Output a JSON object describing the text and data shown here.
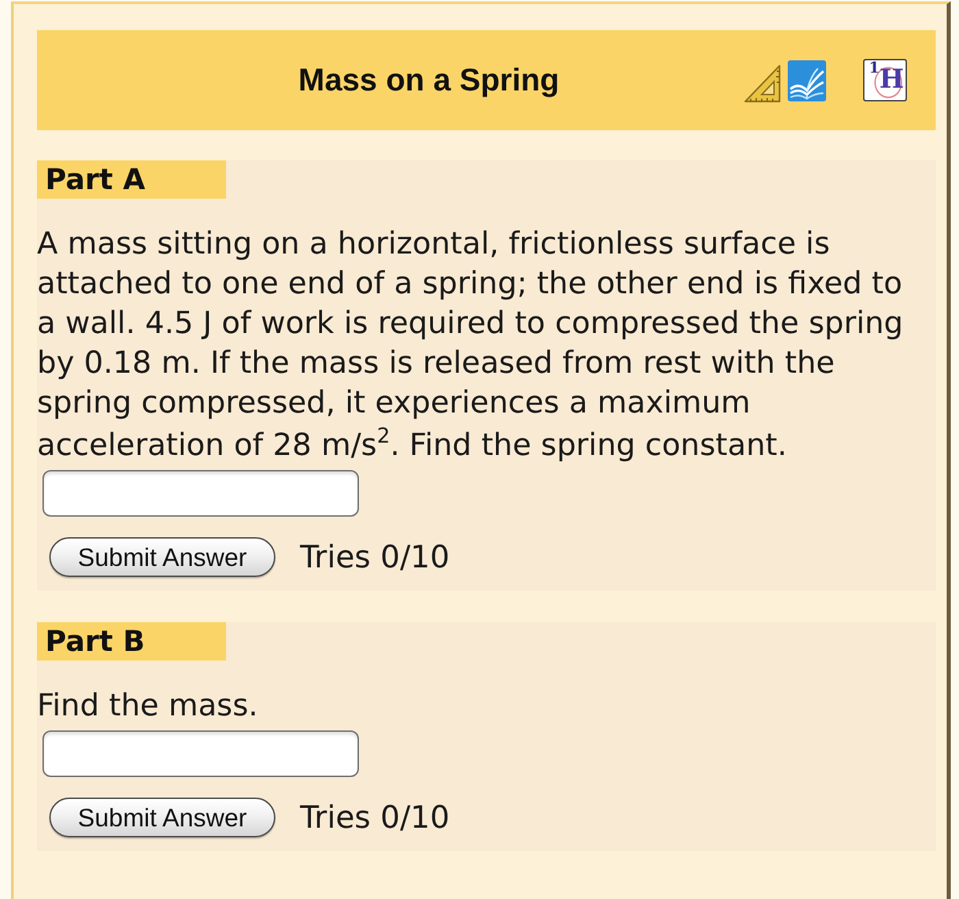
{
  "header": {
    "title": "Mass on a Spring",
    "element_tile": {
      "text": "$^{1}$H"
    }
  },
  "parts": [
    {
      "label": "Part A",
      "question": "A mass sitting on a horizontal, frictionless surface is attached to one end of a spring; the other end is fixed to a wall. 4.5 J of work is required to compressed the spring by 0.18 m. If the mass is released from rest with the spring compressed, it experiences a maximum acceleration of 28 m/s$^{2}$. Find the spring constant.",
      "button": "Submit Answer",
      "tries": "Tries 0/10"
    },
    {
      "label": "Part B",
      "question": "Find the mass.",
      "button": "Submit Answer",
      "tries": "Tries 0/10"
    }
  ]
}
